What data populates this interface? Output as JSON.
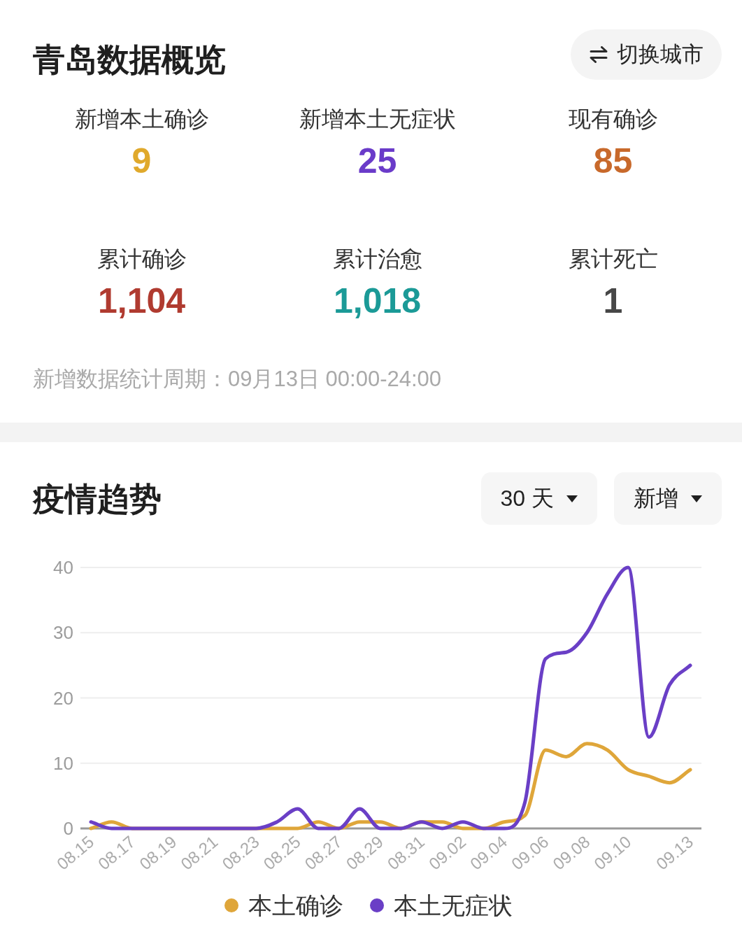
{
  "overview": {
    "title": "青岛数据概览",
    "switch_button": {
      "label": "切换城市"
    },
    "stats": [
      {
        "label": "新增本土确诊",
        "value": "9",
        "color": "#e0a92c"
      },
      {
        "label": "新增本土无症状",
        "value": "25",
        "color": "#6a3bc9"
      },
      {
        "label": "现有确诊",
        "value": "85",
        "color": "#c8692b"
      },
      {
        "label": "累计确诊",
        "value": "1,104",
        "color": "#b03b30"
      },
      {
        "label": "累计治愈",
        "value": "1,018",
        "color": "#1b9a97"
      },
      {
        "label": "累计死亡",
        "value": "1",
        "color": "#474747"
      }
    ],
    "period_note": "新增数据统计周期：09月13日 00:00-24:00"
  },
  "trend": {
    "title": "疫情趋势",
    "range_select": {
      "value": "30 天"
    },
    "type_select": {
      "value": "新增"
    },
    "chart_data": {
      "type": "line",
      "categories": [
        "08.15",
        null,
        "08.17",
        null,
        "08.19",
        null,
        "08.21",
        null,
        "08.23",
        null,
        "08.25",
        null,
        "08.27",
        null,
        "08.29",
        null,
        "08.31",
        null,
        "09.02",
        null,
        "09.04",
        null,
        "09.06",
        null,
        "09.08",
        null,
        "09.10",
        null,
        null,
        "09.13"
      ],
      "ylim": [
        0,
        40
      ],
      "yticks": [
        0,
        10,
        20,
        30,
        40
      ],
      "grid": true,
      "series": [
        {
          "name": "本土确诊",
          "color": "#dfa63a",
          "values": [
            0,
            1,
            0,
            0,
            0,
            0,
            0,
            0,
            0,
            0,
            0,
            1,
            0,
            1,
            1,
            0,
            1,
            1,
            0,
            0,
            1,
            2,
            12,
            11,
            13,
            12,
            9,
            8,
            7,
            9
          ]
        },
        {
          "name": "本土无症状",
          "color": "#6a3fc6",
          "values": [
            1,
            0,
            0,
            0,
            0,
            0,
            0,
            0,
            0,
            1,
            3,
            0,
            0,
            3,
            0,
            0,
            1,
            0,
            1,
            0,
            0,
            4,
            26,
            27,
            30,
            36,
            40,
            14,
            22,
            25
          ]
        }
      ]
    }
  }
}
